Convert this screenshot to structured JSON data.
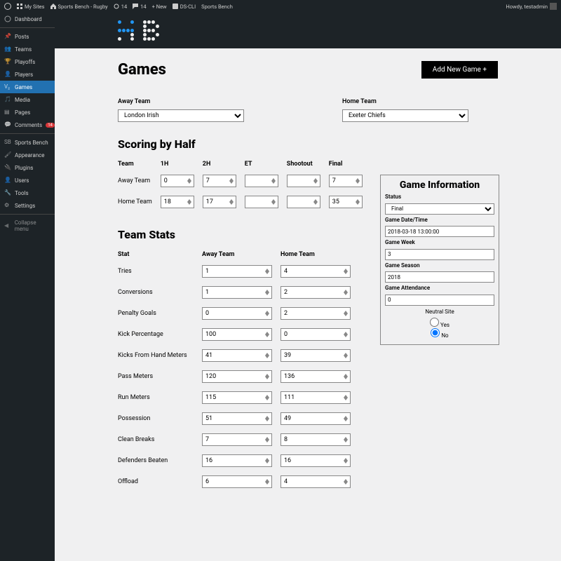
{
  "adminbar": {
    "my_sites": "My Sites",
    "site_name": "Sports Bench - Rugby",
    "updates": "14",
    "comments": "14",
    "new": "+ New",
    "dscli": "DS-CLI",
    "sports_bench": "Sports Bench",
    "howdy": "Howdy, testadmin"
  },
  "sidebar": {
    "dashboard": "Dashboard",
    "posts": "Posts",
    "teams": "Teams",
    "playoffs": "Playoffs",
    "players": "Players",
    "games": "Games",
    "media": "Media",
    "pages": "Pages",
    "comments": "Comments",
    "comments_badge": "14",
    "sportsbench": "Sports Bench",
    "appearance": "Appearance",
    "plugins": "Plugins",
    "users": "Users",
    "tools": "Tools",
    "settings": "Settings",
    "collapse": "Collapse menu"
  },
  "page": {
    "title": "Games",
    "add_new": "Add New Game +"
  },
  "teams": {
    "away_label": "Away Team",
    "home_label": "Home Team",
    "away_value": "London Irish",
    "home_value": "Exeter Chiefs"
  },
  "scoring": {
    "title": "Scoring by Half",
    "cols": {
      "team": "Team",
      "h1": "1H",
      "h2": "2H",
      "et": "ET",
      "so": "Shootout",
      "final": "Final"
    },
    "rows": {
      "away": {
        "label": "Away Team",
        "h1": "0",
        "h2": "7",
        "et": "",
        "so": "",
        "final": "7"
      },
      "home": {
        "label": "Home Team",
        "h1": "18",
        "h2": "17",
        "et": "",
        "so": "",
        "final": "35"
      }
    }
  },
  "teamstats": {
    "title": "Team Stats",
    "head": {
      "stat": "Stat",
      "away": "Away Team",
      "home": "Home Team"
    },
    "rows": [
      {
        "name": "Tries",
        "away": "1",
        "home": "4"
      },
      {
        "name": "Conversions",
        "away": "1",
        "home": "2"
      },
      {
        "name": "Penalty Goals",
        "away": "0",
        "home": "2"
      },
      {
        "name": "Kick Percentage",
        "away": "100",
        "home": "0"
      },
      {
        "name": "Kicks From Hand Meters",
        "away": "41",
        "home": "39"
      },
      {
        "name": "Pass Meters",
        "away": "120",
        "home": "136"
      },
      {
        "name": "Run Meters",
        "away": "115",
        "home": "111"
      },
      {
        "name": "Possession",
        "away": "51",
        "home": "49"
      },
      {
        "name": "Clean Breaks",
        "away": "7",
        "home": "8"
      },
      {
        "name": "Defenders Beaten",
        "away": "16",
        "home": "16"
      },
      {
        "name": "Offload",
        "away": "6",
        "home": "4"
      }
    ]
  },
  "gamebox": {
    "title": "Game Information",
    "status_label": "Status",
    "status_value": "Final",
    "datetime_label": "Game Date/Time",
    "datetime_value": "2018-03-18 13:00:00",
    "week_label": "Game Week",
    "week_value": "3",
    "season_label": "Game Season",
    "season_value": "2018",
    "attendance_label": "Game Attendance",
    "attendance_value": "0",
    "neutral_label": "Neutral Site",
    "yes": "Yes",
    "no": "No",
    "selected": "no"
  }
}
